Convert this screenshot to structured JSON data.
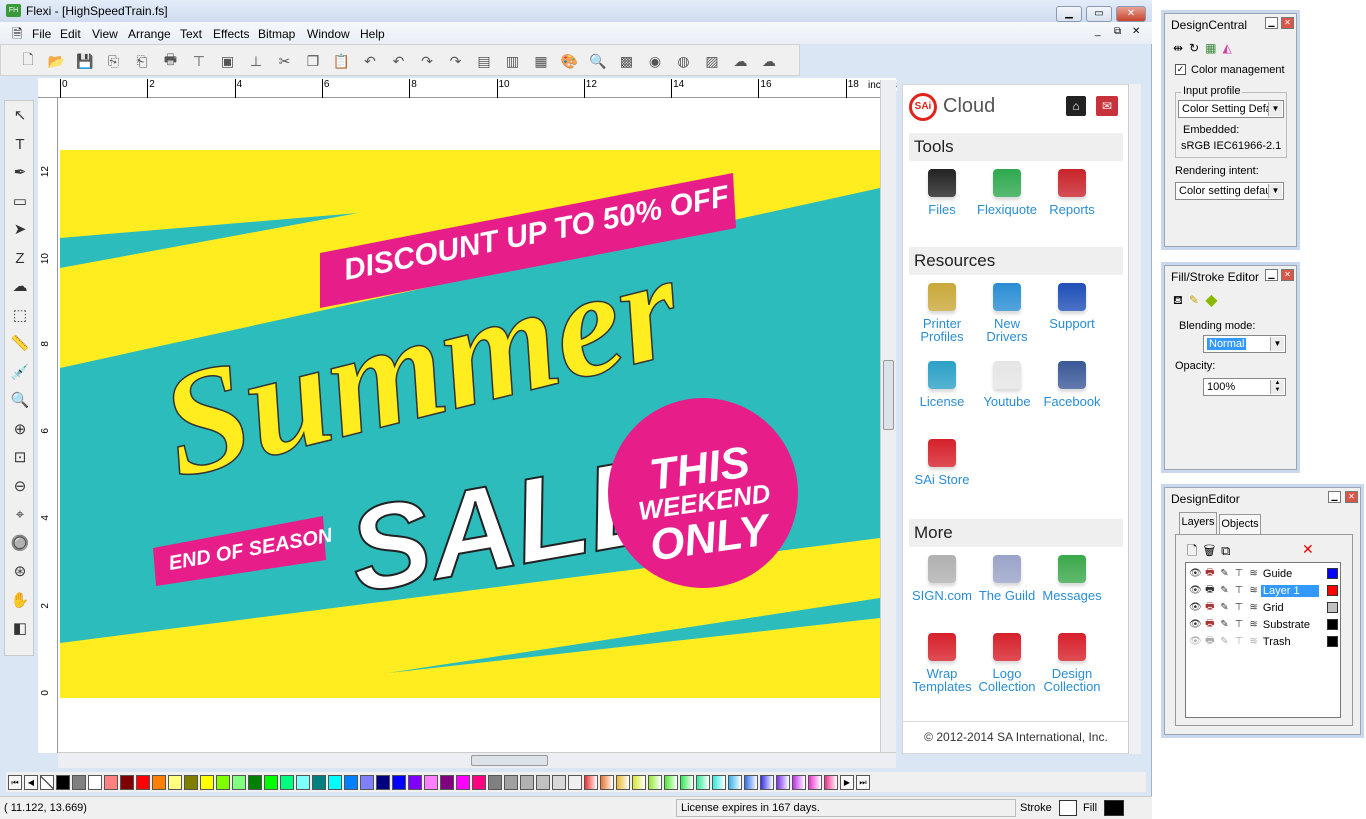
{
  "window": {
    "title": "Flexi - [HighSpeedTrain.fs]",
    "app_icon": "FH",
    "controls": [
      "minimize-icon",
      "maximize-icon",
      "close-icon"
    ]
  },
  "menu": [
    "File",
    "Edit",
    "View",
    "Arrange",
    "Text",
    "Effects",
    "Bitmap",
    "Window",
    "Help"
  ],
  "toolbar_icons": [
    "new",
    "open",
    "save",
    "import",
    "export",
    "print",
    "cut-plot",
    "print-cut",
    "production",
    "cut",
    "copy",
    "paste",
    "undo",
    "undo-multi",
    "redo",
    "redo-multi",
    "layout",
    "align",
    "preview",
    "color-palette",
    "color-picker",
    "swatch",
    "color-wheel",
    "rgb",
    "hatch",
    "cloud-upload",
    "cloud-download"
  ],
  "ruler": {
    "unit": "inches",
    "top_ticks": [
      "0",
      "2",
      "4",
      "6",
      "8",
      "10",
      "12",
      "14",
      "16",
      "18"
    ],
    "left_ticks": [
      "12",
      "10",
      "8",
      "6",
      "4",
      "2",
      "0"
    ]
  },
  "tools": [
    "select",
    "text",
    "pen",
    "rectangle",
    "node-edit",
    "zigzag",
    "blob",
    "crop",
    "measure",
    "eyedropper",
    "zoom",
    "zoom-in",
    "zoom-box",
    "zoom-out",
    "zoom-fit",
    "zoom-selection",
    "zoom-all",
    "pan",
    "fill-stroke"
  ],
  "artwork": {
    "banner_top": "DISCOUNT UP TO 50% OFF",
    "script": "Summer",
    "sale": "SALE",
    "banner_bottom": "END OF SEASON",
    "circle": [
      "THIS",
      "WEEKEND",
      "ONLY"
    ],
    "colors": {
      "yellow": "#ffed1f",
      "teal": "#2cbcbc",
      "pink": "#e71e89",
      "white": "#ffffff"
    }
  },
  "cloud": {
    "brand": "SAi",
    "title": "Cloud",
    "home_icon": "home-icon",
    "mail_icon": "mail-icon",
    "sections": [
      {
        "title": "Tools",
        "items": [
          {
            "label": "Files",
            "color": "#222222"
          },
          {
            "label": "Flexiquote",
            "color": "#2fa84f"
          },
          {
            "label": "Reports",
            "color": "#c8232a"
          }
        ]
      },
      {
        "title": "Resources",
        "items": [
          {
            "label": "Printer Profiles",
            "color": "#c9a83a"
          },
          {
            "label": "New Drivers",
            "color": "#2a8dd4"
          },
          {
            "label": "Support",
            "color": "#1f4fb8"
          },
          {
            "label": "License",
            "color": "#2ba0c7"
          },
          {
            "label": "Youtube",
            "color": "#e5e5e5"
          },
          {
            "label": "Facebook",
            "color": "#3b5998"
          },
          {
            "label": "SAi Store",
            "color": "#d6202a"
          }
        ]
      },
      {
        "title": "More",
        "items": [
          {
            "label": "SIGN.com",
            "color": "#b0b0b0"
          },
          {
            "label": "The Guild",
            "color": "#9aa3c8"
          },
          {
            "label": "Messages",
            "color": "#3aa84a"
          },
          {
            "label": "Wrap Templates",
            "color": "#d6202a"
          },
          {
            "label": "Logo Collection",
            "color": "#d6202a"
          },
          {
            "label": "Design Collection",
            "color": "#d6202a"
          }
        ]
      }
    ],
    "footer": "© 2012-2014 SA International, Inc."
  },
  "palette": [
    "#000000",
    "#808080",
    "#ffffff",
    "#ff8080",
    "#800000",
    "#ff0000",
    "#ff8000",
    "#ffff80",
    "#808000",
    "#ffff00",
    "#80ff00",
    "#80ff80",
    "#008000",
    "#00ff00",
    "#00ff80",
    "#80ffff",
    "#008080",
    "#00ffff",
    "#0080ff",
    "#8080ff",
    "#000080",
    "#0000ff",
    "#8000ff",
    "#ff80ff",
    "#800080",
    "#ff00ff",
    "#ff0080",
    "#808080",
    "#a0a0a0",
    "#b0b0b0",
    "#c0c0c0",
    "#d8d8d8",
    "#f0f0f0"
  ],
  "status": {
    "coords": "(   11.122,     13.669)",
    "license": "License expires in 167 days.",
    "stroke_label": "Stroke",
    "fill_label": "Fill",
    "fill_color": "#000000"
  },
  "design_central": {
    "title": "DesignCentral",
    "tabs": [
      "transform",
      "rotate",
      "bitmap",
      "color"
    ],
    "color_management": "Color management",
    "color_management_checked": true,
    "input_profile_label": "Input profile",
    "input_profile_value": "Color Setting Defau",
    "embedded_label": "Embedded:",
    "embedded_value": "sRGB IEC61966-2.1",
    "rendering_intent_label": "Rendering intent:",
    "rendering_intent_value": "Color setting default"
  },
  "fill_stroke": {
    "title": "Fill/Stroke Editor",
    "blending_label": "Blending mode:",
    "blending_value": "Normal",
    "opacity_label": "Opacity:",
    "opacity_value": "100%"
  },
  "design_editor": {
    "title": "DesignEditor",
    "tabs": [
      "Layers",
      "Objects"
    ],
    "layers": [
      {
        "name": "Guide",
        "color": "#0000ff",
        "selected": false
      },
      {
        "name": "Layer 1",
        "color": "#ff0000",
        "selected": true
      },
      {
        "name": "Grid",
        "color": "#c0c0c0",
        "selected": false
      },
      {
        "name": "Substrate",
        "color": "#000000",
        "selected": false
      },
      {
        "name": "Trash",
        "color": "#000000",
        "selected": false
      }
    ]
  }
}
